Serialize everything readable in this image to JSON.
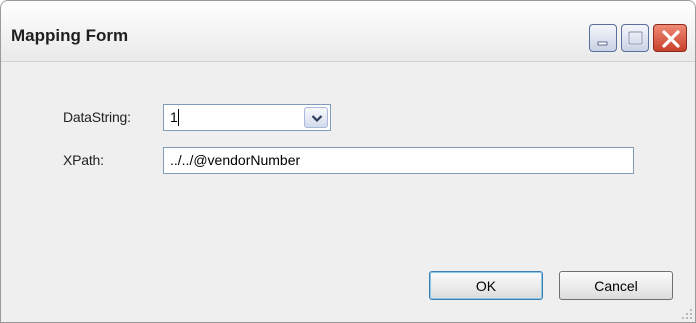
{
  "window": {
    "title": "Mapping Form",
    "controls": [
      "minimize-icon",
      "maximize-icon",
      "close-icon"
    ]
  },
  "form": {
    "datastring": {
      "label": "DataString:",
      "value": "1"
    },
    "xpath": {
      "label": "XPath:",
      "value": "../../@vendorNumber"
    }
  },
  "buttons": {
    "ok": "OK",
    "cancel": "Cancel"
  },
  "colors": {
    "close_button": "#c8402a",
    "input_border": "#7f9db9",
    "default_button_border": "#3c7fb1"
  }
}
